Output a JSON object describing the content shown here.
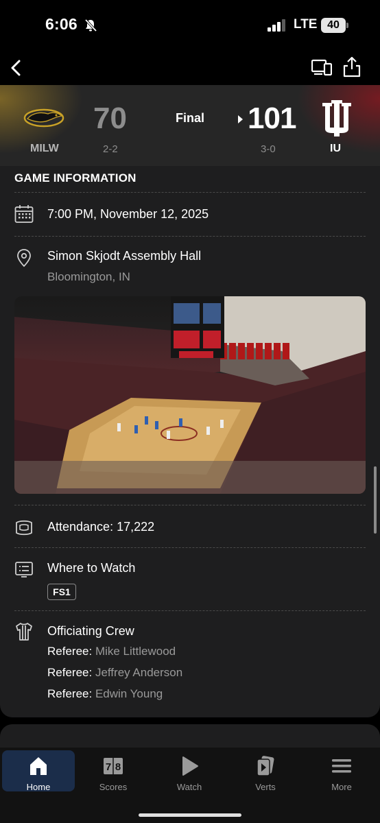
{
  "status_bar": {
    "time": "6:06",
    "network": "LTE",
    "battery": "40"
  },
  "scoreboard": {
    "away": {
      "abbr": "MILW",
      "score": "70",
      "record": "2-2"
    },
    "home": {
      "abbr": "IU",
      "score": "101",
      "record": "3-0"
    },
    "status": "Final"
  },
  "game_info": {
    "title": "GAME INFORMATION",
    "datetime": "7:00 PM, November 12, 2025",
    "venue": "Simon Skjodt Assembly Hall",
    "location": "Bloomington, IN",
    "attendance": "Attendance: 17,222",
    "where_to_watch": "Where to Watch",
    "network": "FS1",
    "officiating_title": "Officiating Crew",
    "referees": [
      {
        "label": "Referee:",
        "name": "Mike Littlewood"
      },
      {
        "label": "Referee:",
        "name": "Jeffrey Anderson"
      },
      {
        "label": "Referee:",
        "name": "Edwin Young"
      }
    ]
  },
  "tabs": [
    {
      "label": "Home",
      "icon": "home-icon",
      "active": true
    },
    {
      "label": "Scores",
      "icon": "scores-icon",
      "active": false
    },
    {
      "label": "Watch",
      "icon": "watch-icon",
      "active": false
    },
    {
      "label": "Verts",
      "icon": "verts-icon",
      "active": false
    },
    {
      "label": "More",
      "icon": "more-icon",
      "active": false
    }
  ],
  "colors": {
    "accent": "#1b2d4a",
    "home_team": "#990000",
    "away_team": "#c9a227",
    "background": "#1e1e1f"
  }
}
